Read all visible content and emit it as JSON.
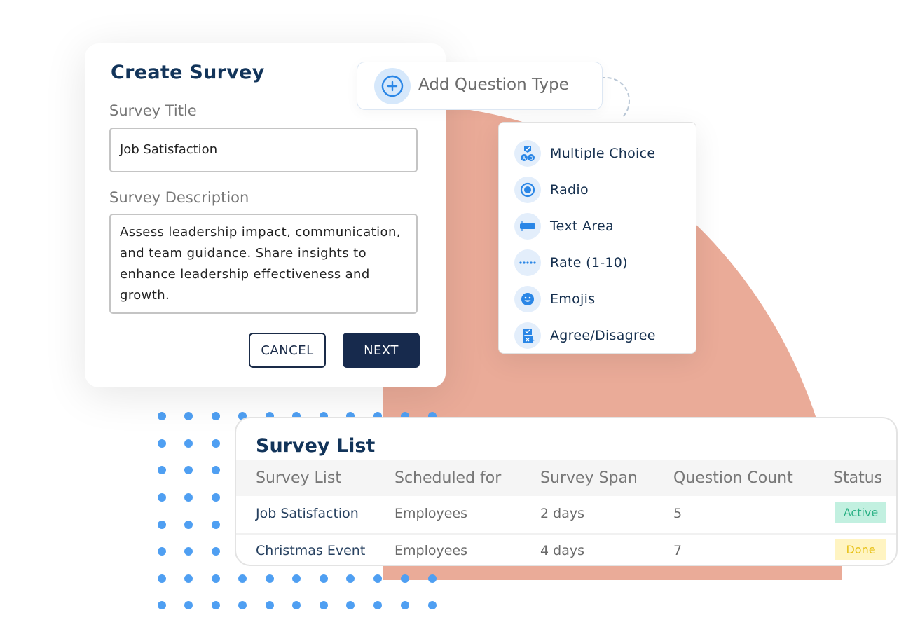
{
  "create_survey": {
    "title": "Create Survey",
    "survey_title_label": "Survey Title",
    "survey_title_value": "Job Satisfaction",
    "survey_description_label": "Survey Description",
    "survey_description_value": "Assess leadership impact, communication, and team guidance. Share insights to enhance leadership effectiveness and growth.",
    "cancel_label": "CANCEL",
    "next_label": "NEXT"
  },
  "add_question": {
    "label": "Add Question Type",
    "icon": "plus-circle-icon"
  },
  "question_types": [
    {
      "label": "Multiple Choice",
      "icon": "multiple-choice-icon"
    },
    {
      "label": "Radio",
      "icon": "radio-icon"
    },
    {
      "label": "Text Area",
      "icon": "text-area-icon"
    },
    {
      "label": "Rate (1-10)",
      "icon": "rating-icon"
    },
    {
      "label": "Emojis",
      "icon": "emoji-icon"
    },
    {
      "label": "Agree/Disagree",
      "icon": "agree-disagree-icon"
    }
  ],
  "survey_list": {
    "title": "Survey List",
    "columns": [
      "Survey List",
      "Scheduled for",
      "Survey Span",
      "Question Count",
      "Status"
    ],
    "rows": [
      {
        "name": "Job Satisfaction",
        "scheduled_for": "Employees",
        "span": "2 days",
        "question_count": "5",
        "status": "Active"
      },
      {
        "name": "Christmas Event",
        "scheduled_for": "Employees",
        "span": "4 days",
        "question_count": "7",
        "status": "Done"
      }
    ]
  },
  "colors": {
    "accent": "#2a86e6",
    "navy": "#172a4d",
    "peach": "#eaab98",
    "status_active_bg": "#c2f0e0",
    "status_active_text": "#2bb185",
    "status_done_bg": "#fff4c2",
    "status_done_text": "#e8c21a"
  }
}
